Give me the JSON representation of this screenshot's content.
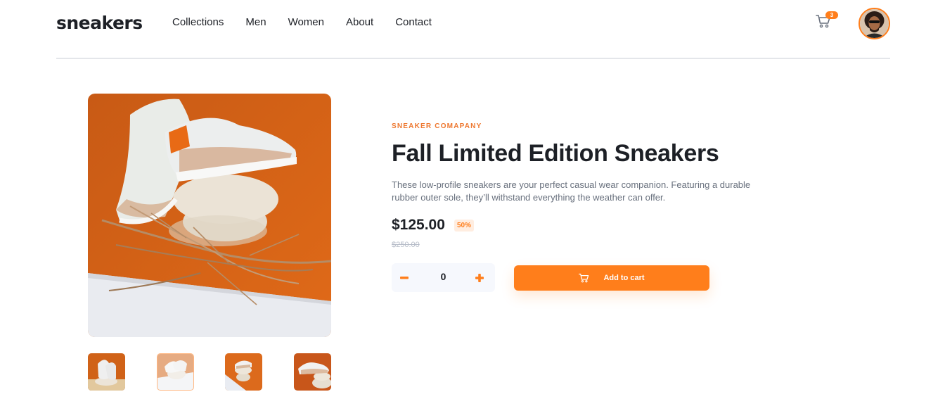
{
  "header": {
    "logo": "sneakers",
    "nav": [
      "Collections",
      "Men",
      "Women",
      "About",
      "Contact"
    ],
    "cart_count": "3"
  },
  "product": {
    "company": "SNEAKER COMAPANY",
    "title": "Fall Limited Edition Sneakers",
    "description": "These low-profile sneakers are your perfect casual wear companion. Featuring a durable rubber outer sole, they’ll withstand everything the weather can offer.",
    "price": "$125.00",
    "discount": "50%",
    "old_price": "$250.00",
    "quantity": "0",
    "add_to_cart_label": "Add to cart"
  },
  "colors": {
    "accent": "#ff7e1b",
    "accent_pale": "#ffede0",
    "text_dark": "#1d2026",
    "text_gray": "#68707d",
    "text_light": "#b6bcc8",
    "qty_bg": "#f6f8fd"
  },
  "icons": [
    "cart-icon",
    "minus-icon",
    "plus-icon",
    "avatar-photo"
  ]
}
